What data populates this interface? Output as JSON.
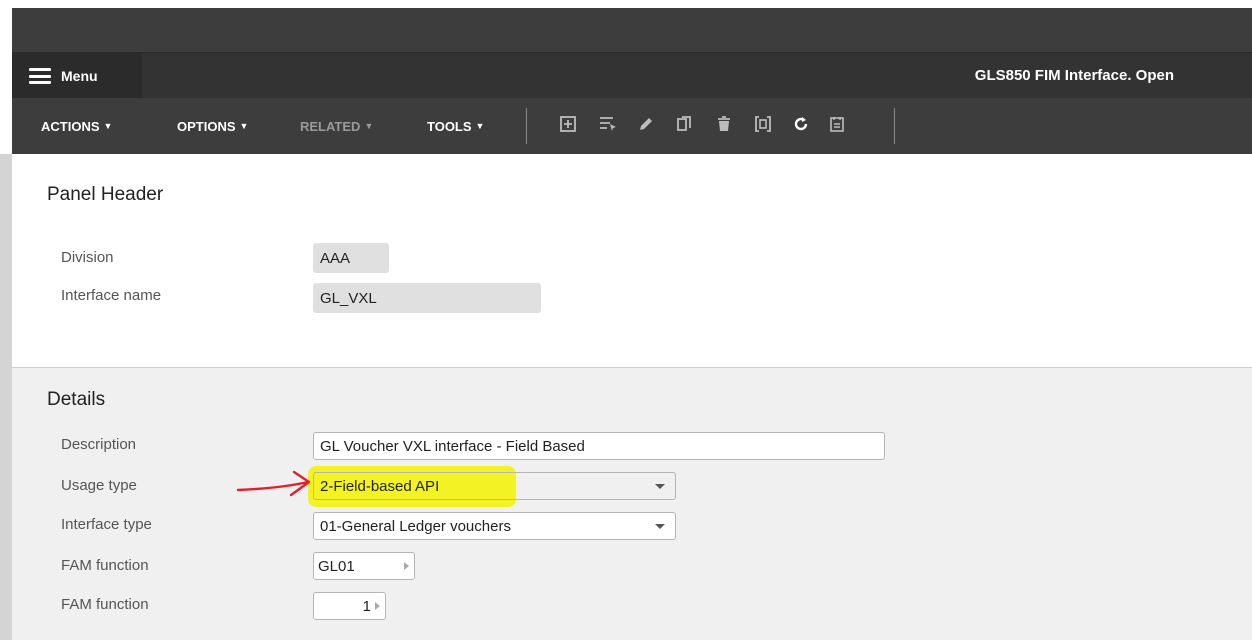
{
  "app": {
    "title": "GLS850 FIM Interface. Open",
    "menu_label": "Menu"
  },
  "toolbar": {
    "menus": [
      {
        "label": "ACTIONS",
        "enabled": true
      },
      {
        "label": "OPTIONS",
        "enabled": true
      },
      {
        "label": "RELATED",
        "enabled": false
      },
      {
        "label": "TOOLS",
        "enabled": true
      }
    ],
    "icons": [
      "add-icon",
      "select-icon",
      "edit-icon",
      "copy-icon",
      "delete-icon",
      "display-icon",
      "refresh-icon",
      "notes-icon"
    ]
  },
  "panel_header": {
    "title": "Panel Header",
    "fields": [
      {
        "label": "Division",
        "value": "AAA"
      },
      {
        "label": "Interface name",
        "value": "GL_VXL"
      }
    ]
  },
  "details": {
    "title": "Details",
    "description": {
      "label": "Description",
      "value": "GL Voucher VXL interface - Field Based"
    },
    "usage_type": {
      "label": "Usage type",
      "value": "2-Field-based API"
    },
    "interface_type": {
      "label": "Interface type",
      "value": "01-General Ledger vouchers"
    },
    "fam_function": {
      "label": "FAM function",
      "value": "GL01"
    },
    "fam_function_version": {
      "label": "FAM function",
      "value": "1"
    }
  },
  "annotation": {
    "highlight_color": "#f2f200",
    "arrow_color": "#e0202a"
  }
}
